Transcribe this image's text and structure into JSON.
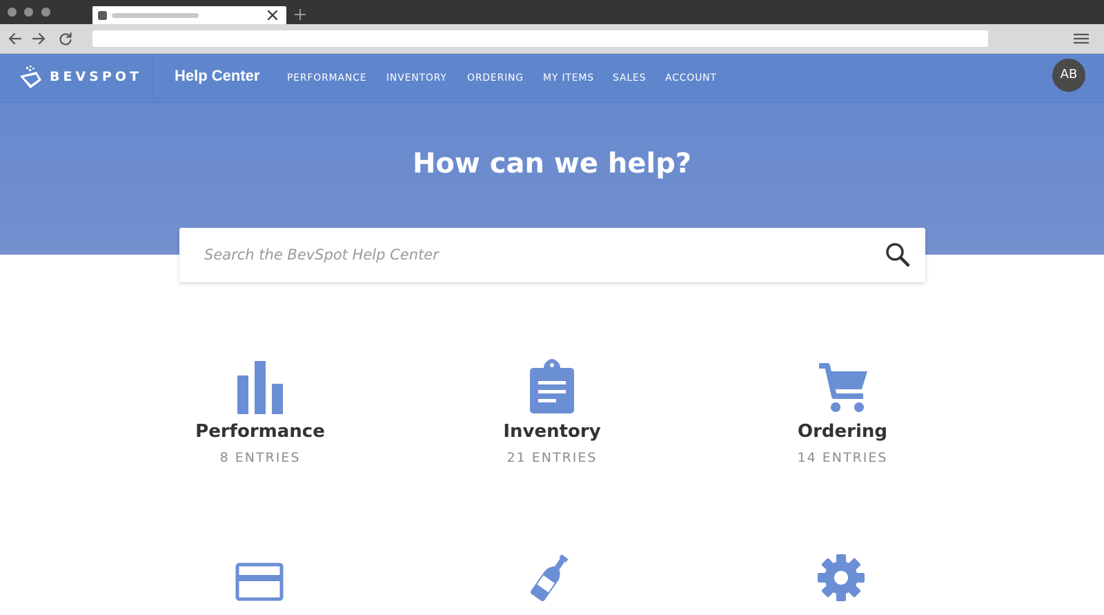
{
  "header": {
    "brand_name": "BEVSPOT",
    "help_title": "Help Center",
    "nav": [
      {
        "label": "PERFORMANCE"
      },
      {
        "label": "INVENTORY"
      },
      {
        "label": "ORDERING"
      },
      {
        "label": "MY ITEMS"
      },
      {
        "label": "SALES"
      },
      {
        "label": "ACCOUNT"
      }
    ],
    "avatar_initials": "AB"
  },
  "hero": {
    "title": "How can we help?"
  },
  "search": {
    "placeholder": "Search the BevSpot Help Center"
  },
  "colors": {
    "brand_blue": "#5f86cc",
    "icon_blue": "#6b8fd4",
    "avatar_bg": "#4a4a4a"
  },
  "categories": [
    {
      "title": "Performance",
      "count": "8 ENTRIES",
      "icon": "bar-chart-icon"
    },
    {
      "title": "Inventory",
      "count": "21 ENTRIES",
      "icon": "clipboard-icon"
    },
    {
      "title": "Ordering",
      "count": "14 ENTRIES",
      "icon": "shopping-cart-icon"
    },
    {
      "icon": "credit-card-icon"
    },
    {
      "icon": "bottle-icon"
    },
    {
      "icon": "gear-icon"
    }
  ]
}
